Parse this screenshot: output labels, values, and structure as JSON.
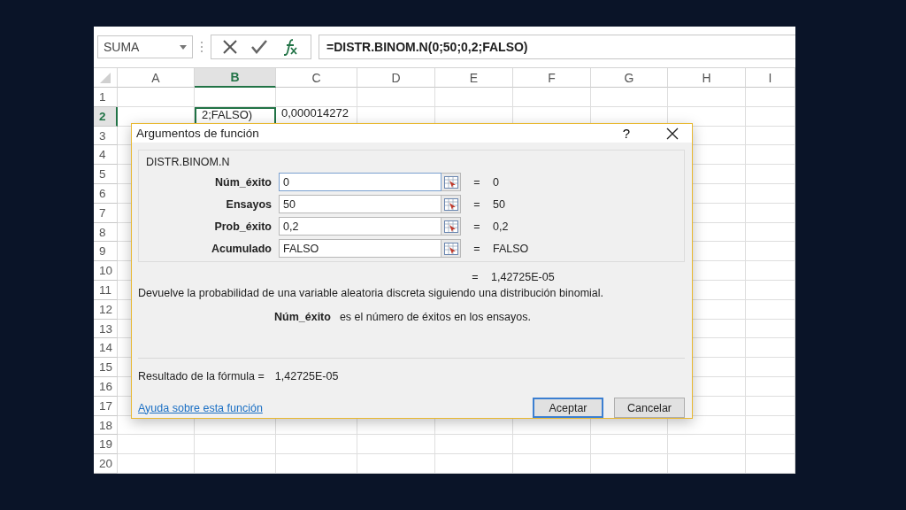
{
  "name_box": {
    "value": "SUMA"
  },
  "formula_bar": {
    "value": "=DISTR.BINOM.N(0;50;0,2;FALSO)"
  },
  "columns": [
    {
      "label": "A",
      "selected": false
    },
    {
      "label": "B",
      "selected": true
    },
    {
      "label": "C",
      "selected": false
    },
    {
      "label": "D",
      "selected": false
    },
    {
      "label": "E",
      "selected": false
    },
    {
      "label": "F",
      "selected": false
    },
    {
      "label": "G",
      "selected": false
    },
    {
      "label": "H",
      "selected": false
    },
    {
      "label": "I",
      "selected": false
    }
  ],
  "rows": [
    {
      "label": "1",
      "selected": false
    },
    {
      "label": "2",
      "selected": true,
      "cell_b": {
        "text": "2;FALSO)",
        "active": true
      },
      "cell_c": {
        "text": "0,000014272",
        "active": false
      }
    },
    {
      "label": "3",
      "selected": false
    },
    {
      "label": "4",
      "selected": false
    },
    {
      "label": "5",
      "selected": false
    },
    {
      "label": "6",
      "selected": false
    },
    {
      "label": "7",
      "selected": false
    },
    {
      "label": "8",
      "selected": false
    },
    {
      "label": "9",
      "selected": false
    },
    {
      "label": "10",
      "selected": false
    },
    {
      "label": "11",
      "selected": false
    },
    {
      "label": "12",
      "selected": false
    },
    {
      "label": "13",
      "selected": false
    },
    {
      "label": "14",
      "selected": false
    },
    {
      "label": "15",
      "selected": false
    },
    {
      "label": "16",
      "selected": false
    },
    {
      "label": "17",
      "selected": false
    },
    {
      "label": "18",
      "selected": false
    },
    {
      "label": "19",
      "selected": false
    },
    {
      "label": "20",
      "selected": false
    }
  ],
  "dialog": {
    "title": "Argumentos de función",
    "help": "?",
    "group_title": "DISTR.BINOM.N",
    "arguments": [
      {
        "label": "Núm_éxito",
        "value": "0",
        "focused": true,
        "equals": "=",
        "result": "0"
      },
      {
        "label": "Ensayos",
        "value": "50",
        "focused": false,
        "equals": "=",
        "result": "50"
      },
      {
        "label": "Prob_éxito",
        "value": "0,2",
        "focused": false,
        "equals": "=",
        "result": "0,2"
      },
      {
        "label": "Acumulado",
        "value": "FALSO",
        "focused": false,
        "equals": "=",
        "result": "FALSO"
      }
    ],
    "total": {
      "equals": "=",
      "result": "1,42725E-05"
    },
    "description": "Devuelve la probabilidad de una variable aleatoria discreta siguiendo una distribución binomial.",
    "argument_help": {
      "name": "Núm_éxito",
      "text": "es el número de éxitos en los ensayos."
    },
    "formula_result": {
      "label": "Resultado de la fórmula =",
      "value": "1,42725E-05"
    },
    "help_link": "Ayuda sobre esta función",
    "buttons": [
      {
        "label": "Aceptar",
        "default": true
      },
      {
        "label": "Cancelar",
        "default": false
      }
    ]
  }
}
